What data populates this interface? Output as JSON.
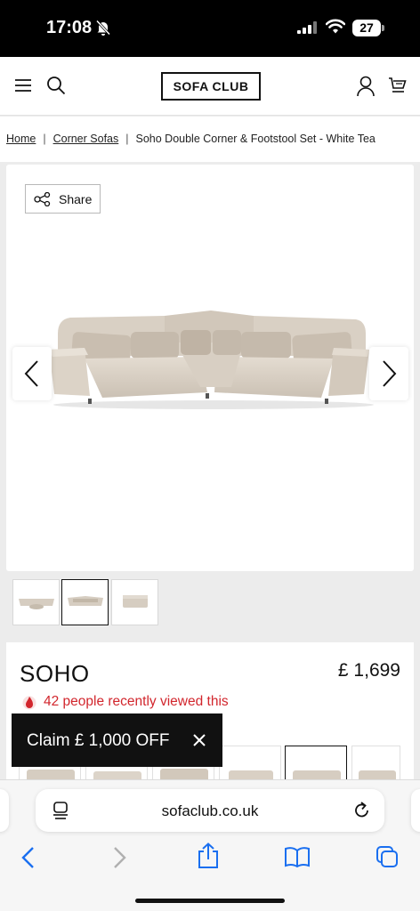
{
  "status_bar": {
    "time": "17:08",
    "battery": "27"
  },
  "header": {
    "logo": "SOFA CLUB"
  },
  "breadcrumb": {
    "home": "Home",
    "category": "Corner Sofas",
    "current": "Soho Double Corner & Footstool Set - White Tea",
    "separator": "|"
  },
  "gallery": {
    "share_label": "Share"
  },
  "product": {
    "name": "SOHO",
    "price": "£ 1,699",
    "viewed_text": "42 people recently viewed this"
  },
  "promo": {
    "claim_label": "Claim £ 1,000 OFF"
  },
  "browser": {
    "url": "sofaclub.co.uk"
  },
  "colors": {
    "accent_red": "#d2262d",
    "sofa_fabric": "#d8cfc3"
  },
  "icons": [
    "bell-slash-icon",
    "signal-icon",
    "wifi-icon",
    "menu-icon",
    "search-icon",
    "account-icon",
    "cart-icon",
    "share-icon",
    "chevron-left-icon",
    "chevron-right-icon",
    "flame-icon",
    "close-icon",
    "reader-icon",
    "reload-icon",
    "back-icon",
    "forward-icon",
    "share-upload-icon",
    "bookmarks-icon",
    "tabs-icon"
  ]
}
